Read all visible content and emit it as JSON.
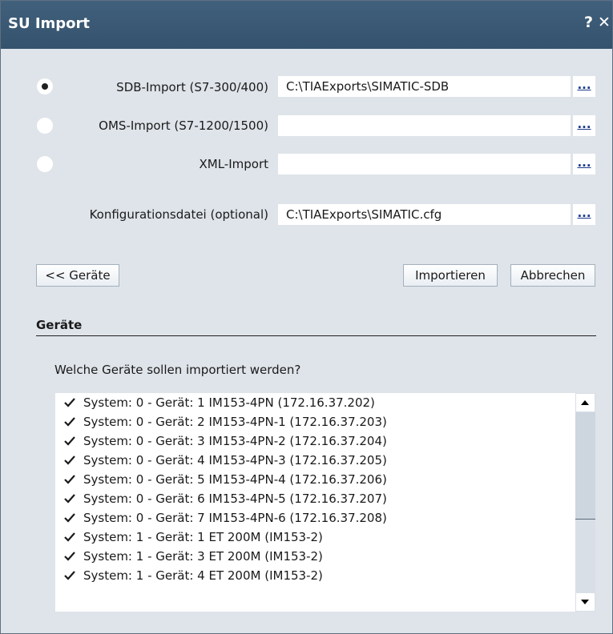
{
  "window": {
    "title": "SU Import",
    "help_glyph": "?",
    "close_glyph": "✕",
    "accent_color": "#3b5a74"
  },
  "import_options": [
    {
      "label": "SDB-Import (S7-300/400)",
      "value": "C:\\TIAExports\\SIMATIC-SDB",
      "selected": true
    },
    {
      "label": "OMS-Import (S7-1200/1500)",
      "value": "",
      "selected": false
    },
    {
      "label": "XML-Import",
      "value": "",
      "selected": false
    }
  ],
  "config": {
    "label": "Konfigurationsdatei (optional)",
    "value": "C:\\TIAExports\\SIMATIC.cfg"
  },
  "browse_label": "...",
  "buttons": {
    "devices": "<< Geräte",
    "import": "Importieren",
    "cancel": "Abbrechen"
  },
  "devices_section": {
    "title": "Geräte",
    "question": "Welche Geräte sollen importiert werden?",
    "items": [
      "System: 0 - Gerät: 1 IM153-4PN (172.16.37.202)",
      "System: 0 - Gerät: 2 IM153-4PN-1 (172.16.37.203)",
      "System: 0 - Gerät: 3 IM153-4PN-2 (172.16.37.204)",
      "System: 0 - Gerät: 4 IM153-4PN-3 (172.16.37.205)",
      "System: 0 - Gerät: 5 IM153-4PN-4 (172.16.37.206)",
      "System: 0 - Gerät: 6 IM153-4PN-5 (172.16.37.207)",
      "System: 0 - Gerät: 7 IM153-4PN-6 (172.16.37.208)",
      "System: 1 - Gerät: 1 ET 200M (IM153-2)",
      "System: 1 - Gerät: 3 ET 200M (IM153-2)",
      "System: 1 - Gerät: 4 ET 200M (IM153-2)"
    ]
  }
}
